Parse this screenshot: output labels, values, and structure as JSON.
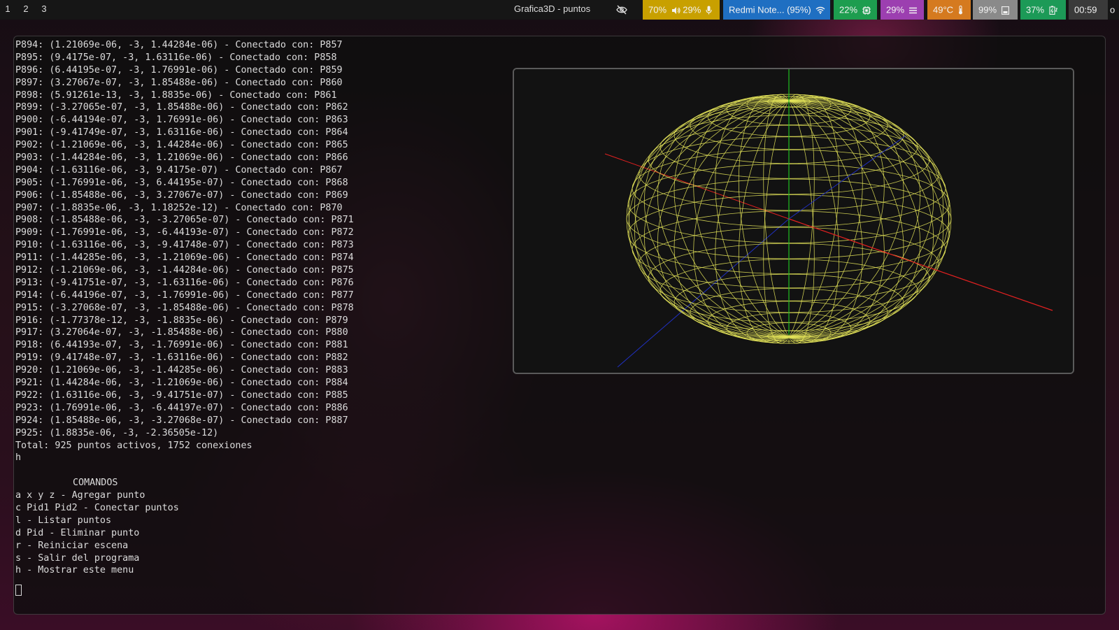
{
  "topbar": {
    "workspaces": [
      "1",
      "2",
      "3"
    ],
    "window_title": "Grafica3D - puntos",
    "modules": {
      "audio": {
        "volume": "70%",
        "mic": "29%",
        "color": "#c8a000"
      },
      "wifi": {
        "label": "Redmi Note... (95%)",
        "color": "#1f6fc2"
      },
      "cpu": {
        "label": "22%",
        "color": "#1d9d4f"
      },
      "memory": {
        "label": "29%",
        "color": "#9c3fb0"
      },
      "temperature": {
        "label": "49°C",
        "color": "#d57a1f"
      },
      "disk": {
        "label": "99%",
        "color": "#8a8a8a"
      },
      "battery": {
        "label": "37%",
        "color": "#1c9a57"
      },
      "clock": {
        "label": "00:59",
        "color": "#3a3a3a"
      },
      "tray": {
        "label": "o"
      }
    }
  },
  "terminal": {
    "lines": [
      "P894: (1.21069e-06, -3, 1.44284e-06) - Conectado con: P857",
      "P895: (9.4175e-07, -3, 1.63116e-06) - Conectado con: P858",
      "P896: (6.44195e-07, -3, 1.76991e-06) - Conectado con: P859",
      "P897: (3.27067e-07, -3, 1.85488e-06) - Conectado con: P860",
      "P898: (5.91261e-13, -3, 1.8835e-06) - Conectado con: P861",
      "P899: (-3.27065e-07, -3, 1.85488e-06) - Conectado con: P862",
      "P900: (-6.44194e-07, -3, 1.76991e-06) - Conectado con: P863",
      "P901: (-9.41749e-07, -3, 1.63116e-06) - Conectado con: P864",
      "P902: (-1.21069e-06, -3, 1.44284e-06) - Conectado con: P865",
      "P903: (-1.44284e-06, -3, 1.21069e-06) - Conectado con: P866",
      "P904: (-1.63116e-06, -3, 9.4175e-07) - Conectado con: P867",
      "P905: (-1.76991e-06, -3, 6.44195e-07) - Conectado con: P868",
      "P906: (-1.85488e-06, -3, 3.27067e-07) - Conectado con: P869",
      "P907: (-1.8835e-06, -3, 1.18252e-12) - Conectado con: P870",
      "P908: (-1.85488e-06, -3, -3.27065e-07) - Conectado con: P871",
      "P909: (-1.76991e-06, -3, -6.44193e-07) - Conectado con: P872",
      "P910: (-1.63116e-06, -3, -9.41748e-07) - Conectado con: P873",
      "P911: (-1.44285e-06, -3, -1.21069e-06) - Conectado con: P874",
      "P912: (-1.21069e-06, -3, -1.44284e-06) - Conectado con: P875",
      "P913: (-9.41751e-07, -3, -1.63116e-06) - Conectado con: P876",
      "P914: (-6.44196e-07, -3, -1.76991e-06) - Conectado con: P877",
      "P915: (-3.27068e-07, -3, -1.85488e-06) - Conectado con: P878",
      "P916: (-1.77378e-12, -3, -1.8835e-06) - Conectado con: P879",
      "P917: (3.27064e-07, -3, -1.85488e-06) - Conectado con: P880",
      "P918: (6.44193e-07, -3, -1.76991e-06) - Conectado con: P881",
      "P919: (9.41748e-07, -3, -1.63116e-06) - Conectado con: P882",
      "P920: (1.21069e-06, -3, -1.44285e-06) - Conectado con: P883",
      "P921: (1.44284e-06, -3, -1.21069e-06) - Conectado con: P884",
      "P922: (1.63116e-06, -3, -9.41751e-07) - Conectado con: P885",
      "P923: (1.76991e-06, -3, -6.44197e-07) - Conectado con: P886",
      "P924: (1.85488e-06, -3, -3.27068e-07) - Conectado con: P887",
      "P925: (1.8835e-06, -3, -2.36505e-12)",
      "Total: 925 puntos activos, 1752 conexiones",
      "h",
      ""
    ],
    "commands_title": "COMANDOS",
    "commands": [
      "a x y z - Agregar punto",
      "c Pid1 Pid2 - Conectar puntos",
      "l - Listar puntos",
      "d Pid - Eliminar punto",
      "r - Reiniciar escena",
      "s - Salir del programa",
      "h - Mostrar este menu"
    ]
  },
  "viewer": {
    "colors": {
      "wire": "#e8e85a",
      "x_axis": "#e02020",
      "y_axis": "#20c020",
      "z_axis": "#2030c0",
      "background": "#121212"
    },
    "parallels": 24,
    "meridians": 40
  }
}
